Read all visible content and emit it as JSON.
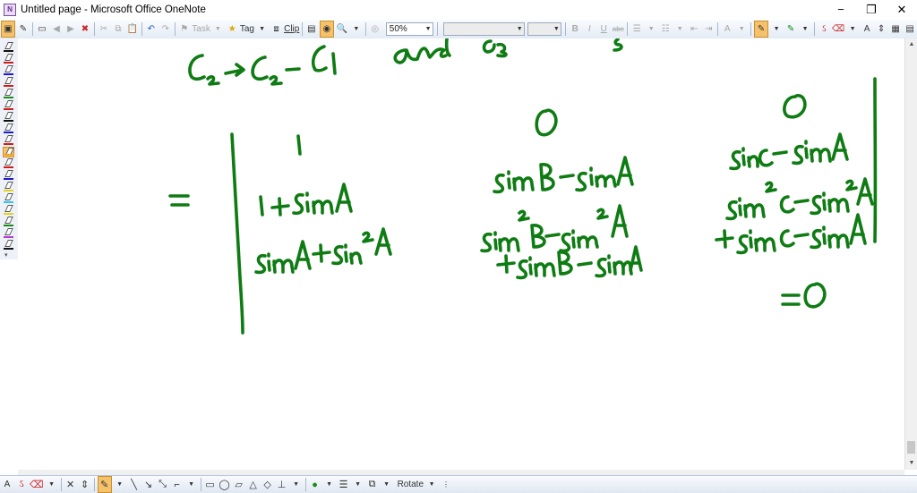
{
  "window": {
    "title": "Untitled page - Microsoft Office OneNote",
    "minimize": "−",
    "restore": "❐",
    "close": "✕"
  },
  "toolbar": {
    "task_label": "Task",
    "tag_label": "Tag",
    "clip_label": "Clip",
    "zoom_value": "50%",
    "font_value": "",
    "size_value": "",
    "bold": "B",
    "italic": "I",
    "underline": "U",
    "strike": "abc"
  },
  "drawing_toolbar": {
    "rotate_label": "Rotate"
  },
  "icons": {
    "pen_colors": [
      "#111111",
      "#d11b1b",
      "#1a1acc",
      "#d11b1b",
      "#1a8a1a",
      "#d11b1b",
      "#111111",
      "#1a1acc",
      "#d11b1b",
      "#f2a31b",
      "#d11b1b",
      "#1a1acc",
      "#e6d21a",
      "#2ec4e6",
      "#e6d21a",
      "#1a8a1a",
      "#b23bd6",
      "#111111"
    ],
    "highlight_color": "#f2c21b",
    "ink_color": "#0e7c13"
  }
}
